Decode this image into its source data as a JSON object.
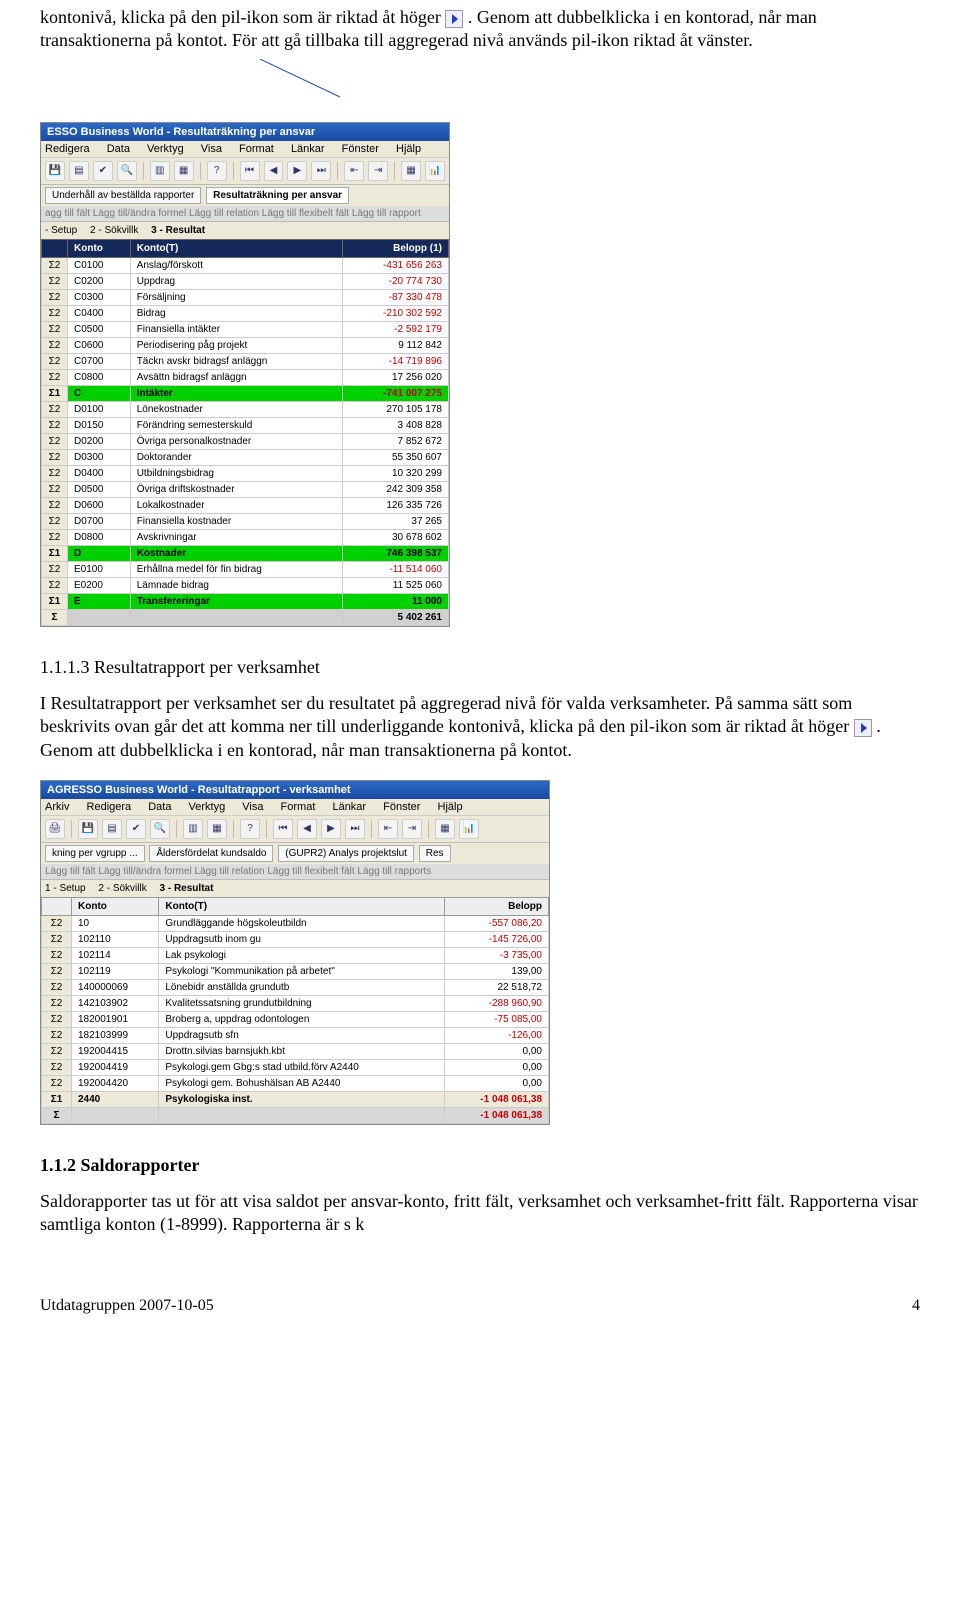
{
  "intro": {
    "p1a": "kontonivå, klicka på den pil-ikon som är riktad åt höger ",
    "p1b": ". Genom att dubbelklicka i en kontorad, når man transaktionerna på kontot. För att gå tillbaka till aggregerad nivå används pil-ikon riktad åt vänster."
  },
  "shot1": {
    "title": "ESSO Business World - Resultaträkning per ansvar",
    "menu": [
      "Redigera",
      "Data",
      "Verktyg",
      "Visa",
      "Format",
      "Länkar",
      "Fönster",
      "Hjälp"
    ],
    "tab1": "Underhåll av beställda rapporter",
    "tab2": "Resultaträkning per ansvar",
    "graybar": "agg till fält  Lägg till/ändra formel  Lägg till relation  Lägg till flexibelt fält  Lägg till rapport",
    "sub1": "- Setup",
    "sub2": "2 - Sökvillk",
    "sub3": "3 - Resultat",
    "cols": [
      "",
      "Konto",
      "Konto(T)",
      "Belopp (1)"
    ],
    "rows": [
      {
        "s": "Σ2",
        "k": "C0100",
        "t": "Anslag/förskott",
        "b": "-431 656 263",
        "n": true
      },
      {
        "s": "Σ2",
        "k": "C0200",
        "t": "Uppdrag",
        "b": "-20 774 730",
        "n": true
      },
      {
        "s": "Σ2",
        "k": "C0300",
        "t": "Försäljning",
        "b": "-87 330 478",
        "n": true
      },
      {
        "s": "Σ2",
        "k": "C0400",
        "t": "Bidrag",
        "b": "-210 302 592",
        "n": true
      },
      {
        "s": "Σ2",
        "k": "C0500",
        "t": "Finansiella intäkter",
        "b": "-2 592 179",
        "n": true
      },
      {
        "s": "Σ2",
        "k": "C0600",
        "t": "Periodisering påg projekt",
        "b": "9 112 842"
      },
      {
        "s": "Σ2",
        "k": "C0700",
        "t": "Täckn avskr bidragsf anläggn",
        "b": "-14 719 896",
        "n": true
      },
      {
        "s": "Σ2",
        "k": "C0800",
        "t": "Avsättn bidragsf anläggn",
        "b": "17 256 020"
      },
      {
        "s": "Σ1",
        "k": "C",
        "t": "Intäkter",
        "b": "-741 007 275",
        "n": true,
        "sum": true
      },
      {
        "s": "Σ2",
        "k": "D0100",
        "t": "Lönekostnader",
        "b": "270 105 178"
      },
      {
        "s": "Σ2",
        "k": "D0150",
        "t": "Förändring semesterskuld",
        "b": "3 408 828"
      },
      {
        "s": "Σ2",
        "k": "D0200",
        "t": "Övriga personalkostnader",
        "b": "7 852 672"
      },
      {
        "s": "Σ2",
        "k": "D0300",
        "t": "Doktorander",
        "b": "55 350 607"
      },
      {
        "s": "Σ2",
        "k": "D0400",
        "t": "Utbildningsbidrag",
        "b": "10 320 299"
      },
      {
        "s": "Σ2",
        "k": "D0500",
        "t": "Övriga driftskostnader",
        "b": "242 309 358"
      },
      {
        "s": "Σ2",
        "k": "D0600",
        "t": "Lokalkostnader",
        "b": "126 335 726"
      },
      {
        "s": "Σ2",
        "k": "D0700",
        "t": "Finansiella kostnader",
        "b": "37 265"
      },
      {
        "s": "Σ2",
        "k": "D0800",
        "t": "Avskrivningar",
        "b": "30 678 602"
      },
      {
        "s": "Σ1",
        "k": "D",
        "t": "Kostnader",
        "b": "746 398 537",
        "sum": true
      },
      {
        "s": "Σ2",
        "k": "E0100",
        "t": "Erhållna medel för fin bidrag",
        "b": "-11 514 060",
        "n": true
      },
      {
        "s": "Σ2",
        "k": "E0200",
        "t": "Lämnade bidrag",
        "b": "11 525 060"
      },
      {
        "s": "Σ1",
        "k": "E",
        "t": "Transfereringar",
        "b": "11 000",
        "sum": true
      },
      {
        "s": "Σ",
        "k": "",
        "t": "",
        "b": "5 402 261",
        "tot": true
      }
    ]
  },
  "sec113": {
    "heading": "1.1.1.3 Resultatrapport per verksamhet",
    "p1": "I Resultatrapport per verksamhet ser du resultatet på aggregerad nivå för valda verksamheter. På samma sätt som beskrivits ovan går det att komma ner till underliggande kontonivå, klicka på den pil-ikon som är riktad åt höger ",
    "p2": ". Genom att dubbelklicka i en kontorad, når man transaktionerna på kontot."
  },
  "shot2": {
    "title": "AGRESSO Business World - Resultatrapport - verksamhet",
    "menu": [
      "Arkiv",
      "Redigera",
      "Data",
      "Verktyg",
      "Visa",
      "Format",
      "Länkar",
      "Fönster",
      "Hjälp"
    ],
    "tab1": "kning per vgrupp ...",
    "tab2": "Åldersfördelat kundsaldo",
    "tab3": "(GUPR2) Analys projektslut",
    "tab4": "Res",
    "graybar": "Lägg till fält  Lägg till/ändra formel  Lägg till relation  Lägg till flexibelt fält  Lägg till rapports",
    "sub1": "1 - Setup",
    "sub2": "2 - Sökvillk",
    "sub3": "3 - Resultat",
    "cols": [
      "",
      "Konto",
      "Konto(T)",
      "Belopp"
    ],
    "rows": [
      {
        "s": "Σ2",
        "k": "10",
        "t": "Grundläggande högskoleutbildn",
        "b": "-557 086,20",
        "n": true
      },
      {
        "s": "Σ2",
        "k": "102110",
        "t": "Uppdragsutb inom gu",
        "b": "-145 726,00",
        "n": true
      },
      {
        "s": "Σ2",
        "k": "102114",
        "t": "Lak psykologi",
        "b": "-3 735,00",
        "n": true
      },
      {
        "s": "Σ2",
        "k": "102119",
        "t": "Psykologi \"Kommunikation på arbetet\"",
        "b": "139,00"
      },
      {
        "s": "Σ2",
        "k": "140000069",
        "t": "Lönebidr anställda grundutb",
        "b": "22 518,72"
      },
      {
        "s": "Σ2",
        "k": "142103902",
        "t": "Kvalitetssatsning grundutbildning",
        "b": "-288 960,90",
        "n": true
      },
      {
        "s": "Σ2",
        "k": "182001901",
        "t": "Broberg a, uppdrag odontologen",
        "b": "-75 085,00",
        "n": true
      },
      {
        "s": "Σ2",
        "k": "182103999",
        "t": "Uppdragsutb sfn",
        "b": "-126,00",
        "n": true
      },
      {
        "s": "Σ2",
        "k": "192004415",
        "t": "Drottn.silvias barnsjukh.kbt",
        "b": "0,00"
      },
      {
        "s": "Σ2",
        "k": "192004419",
        "t": "Psykologi.gem Gbg:s stad utbild.förv A2440",
        "b": "0,00"
      },
      {
        "s": "Σ2",
        "k": "192004420",
        "t": "Psykologi gem. Bohushälsan AB  A2440",
        "b": "0,00"
      },
      {
        "s": "Σ1",
        "k": "2440",
        "t": "Psykologiska inst.",
        "b": "-1 048 061,38",
        "n": true,
        "sum": true
      },
      {
        "s": "Σ",
        "k": "",
        "t": "",
        "b": "-1 048 061,38",
        "n": true,
        "tot": true
      }
    ]
  },
  "sec112": {
    "heading": "1.1.2   Saldorapporter",
    "p": "Saldorapporter tas ut för att visa saldot per ansvar-konto, fritt fält, verksamhet och verksamhet-fritt fält. Rapporterna visar samtliga konton (1-8999). Rapporterna är s k"
  },
  "footer": {
    "left": "Utdatagruppen 2007-10-05",
    "right": "4"
  }
}
